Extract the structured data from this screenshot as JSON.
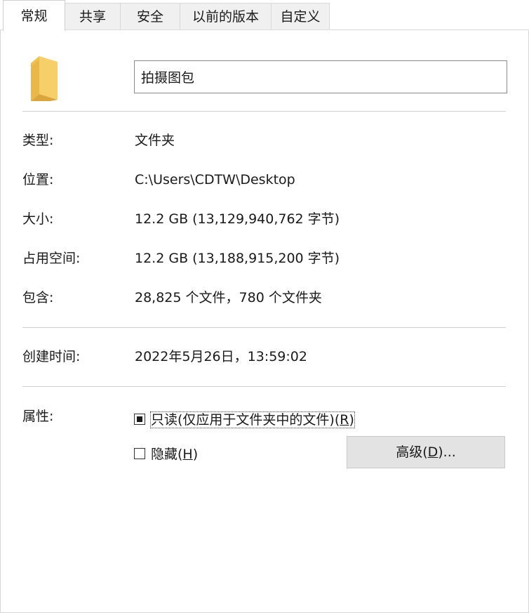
{
  "tabs": [
    {
      "label": "常规",
      "active": true
    },
    {
      "label": "共享",
      "active": false
    },
    {
      "label": "安全",
      "active": false
    },
    {
      "label": "以前的版本",
      "active": false
    },
    {
      "label": "自定义",
      "active": false
    }
  ],
  "folder": {
    "icon": "folder-icon",
    "name": "拍摄图包"
  },
  "properties": {
    "type_label": "类型:",
    "type_value": "文件夹",
    "location_label": "位置:",
    "location_value": "C:\\Users\\CDTW\\Desktop",
    "size_label": "大小:",
    "size_value": "12.2 GB (13,129,940,762 字节)",
    "size_on_disk_label": "占用空间:",
    "size_on_disk_value": "12.2 GB (13,188,915,200 字节)",
    "contains_label": "包含:",
    "contains_value": "28,825 个文件，780 个文件夹",
    "created_label": "创建时间:",
    "created_value": "2022年5月26日，13:59:02"
  },
  "attributes": {
    "label": "属性:",
    "readonly": {
      "text": "只读(仅应用于文件夹中的文件)(",
      "key": "R",
      "suffix": ")",
      "state": "indeterminate"
    },
    "hidden": {
      "text": "隐藏(",
      "key": "H",
      "suffix": ")",
      "state": "unchecked"
    },
    "advanced_button": {
      "text": "高级(",
      "key": "D",
      "suffix": ")..."
    }
  },
  "colors": {
    "folder": "#f7cf68",
    "folder_back": "#e8b84a",
    "tab_bg": "#f0f0f0",
    "button_bg": "#e3e3e3"
  }
}
